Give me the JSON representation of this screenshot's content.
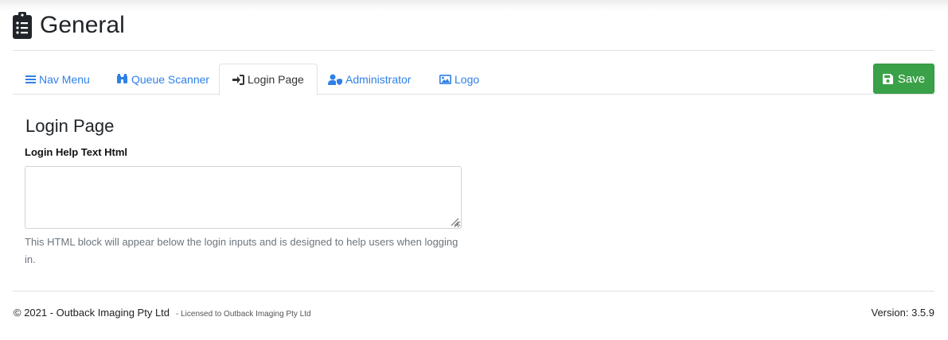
{
  "header": {
    "title": "General",
    "icon": "clipboard-list-icon"
  },
  "tabs": [
    {
      "label": "Nav Menu",
      "icon": "bars-icon",
      "active": false
    },
    {
      "label": "Queue Scanner",
      "icon": "binoculars-icon",
      "active": false
    },
    {
      "label": "Login Page",
      "icon": "sign-in-icon",
      "active": true
    },
    {
      "label": "Administrator",
      "icon": "user-shield-icon",
      "active": false
    },
    {
      "label": "Logo",
      "icon": "image-icon",
      "active": false
    }
  ],
  "toolbar": {
    "save_label": "Save",
    "save_icon": "save-icon"
  },
  "section": {
    "title": "Login Page",
    "field_label": "Login Help Text Html",
    "field_value": "",
    "help_text": "This HTML block will appear below the login inputs and is designed to help users when logging in."
  },
  "footer": {
    "copyright": "© 2021 - Outback Imaging Pty Ltd",
    "license": "- Licensed to Outback Imaging Pty Ltd",
    "version": "Version: 3.5.9"
  },
  "colors": {
    "link": "#2f80e8",
    "save_button": "#3aa148",
    "help_text": "#6c757d"
  }
}
